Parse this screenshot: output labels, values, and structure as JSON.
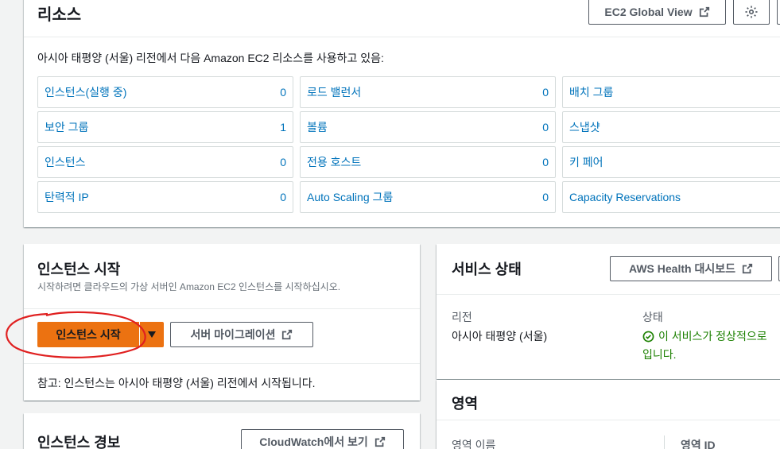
{
  "resources": {
    "title": "리소스",
    "global_view_button": "EC2 Global View",
    "description": "아시아 태평양 (서울) 리전에서 다음 Amazon EC2 리소스를 사용하고 있음:",
    "items": [
      {
        "label": "인스턴스(실행 중)",
        "count": "0"
      },
      {
        "label": "로드 밸런서",
        "count": "0"
      },
      {
        "label": "배치 그룹",
        "count": ""
      },
      {
        "label": "보안 그룹",
        "count": "1"
      },
      {
        "label": "볼륨",
        "count": "0"
      },
      {
        "label": "스냅샷",
        "count": ""
      },
      {
        "label": "인스턴스",
        "count": "0"
      },
      {
        "label": "전용 호스트",
        "count": "0"
      },
      {
        "label": "키 페어",
        "count": ""
      },
      {
        "label": "탄력적 IP",
        "count": "0"
      },
      {
        "label": "Auto Scaling 그룹",
        "count": "0"
      },
      {
        "label": "Capacity Reservations",
        "count": ""
      }
    ]
  },
  "launch": {
    "title": "인스턴스 시작",
    "subtitle": "시작하려면 클라우드의 가상 서버인 Amazon EC2 인스턴스를 시작하십시오.",
    "launch_button": "인스턴스 시작",
    "migrate_button": "서버 마이그레이션",
    "note": "참고: 인스턴스는 아시아 태평양 (서울) 리전에서 시작됩니다."
  },
  "alarms": {
    "title": "인스턴스 경보",
    "cloudwatch_button": "CloudWatch에서 보기"
  },
  "service_health": {
    "title": "서비스 상태",
    "dashboard_button": "AWS Health 대시보드",
    "region_label": "리전",
    "region_value": "아시아 태평양 (서울)",
    "status_label": "상태",
    "status_line1": "이 서비스가 정상적으로 ",
    "status_line2": "입니다."
  },
  "zones": {
    "title": "영역",
    "col_name": "영역 이름",
    "col_id": "영역 ID"
  },
  "colors": {
    "primary": "#ec7211",
    "link": "#0073bb",
    "success": "#1d8102",
    "annotation": "#e02020"
  },
  "icons": [
    "external-link-icon",
    "gear-icon",
    "caret-down-icon",
    "check-circle-icon"
  ]
}
